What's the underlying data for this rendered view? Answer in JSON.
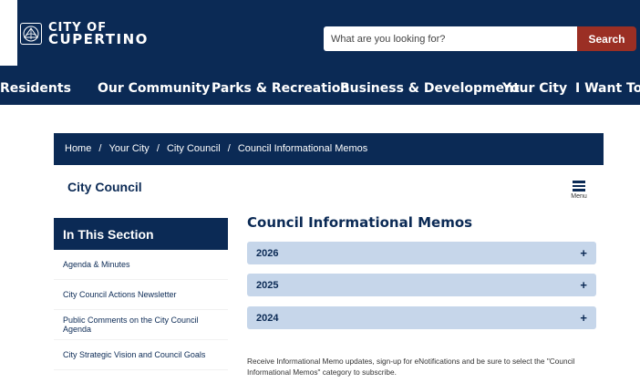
{
  "header": {
    "logo_line1": "CITY OF",
    "logo_line2": "CUPERTINO",
    "seal_icon": "city-seal-icon",
    "search_placeholder": "What are you looking for?",
    "search_button": "Search",
    "colors": {
      "navy": "#0b2a55",
      "search_button": "#9b2f24",
      "accordion": "#c6d6ea"
    }
  },
  "nav": {
    "items": [
      "Residents",
      "Our Community",
      "Parks & Recreation",
      "Business & Development",
      "Your City",
      "I Want To..."
    ]
  },
  "breadcrumb": {
    "items": [
      "Home",
      "Your City",
      "City Council",
      "Council Informational Memos"
    ],
    "separator": "/"
  },
  "page": {
    "council_title": "City Council",
    "menu_label": "Menu",
    "main_title": "Council Informational Memos"
  },
  "sidebar": {
    "heading": "In This Section",
    "items": [
      "Agenda & Minutes",
      "City Council Actions Newsletter",
      "Public Comments on the City Council Agenda",
      "City Strategic Vision and Council Goals"
    ]
  },
  "accordions": [
    {
      "label": "2026",
      "icon": "+"
    },
    {
      "label": "2025",
      "icon": "+"
    },
    {
      "label": "2024",
      "icon": "+"
    }
  ],
  "notice": "Receive Informational Memo updates, sign-up for eNotifications and be sure to select the \"Council Informational Memos\" category to subscribe."
}
